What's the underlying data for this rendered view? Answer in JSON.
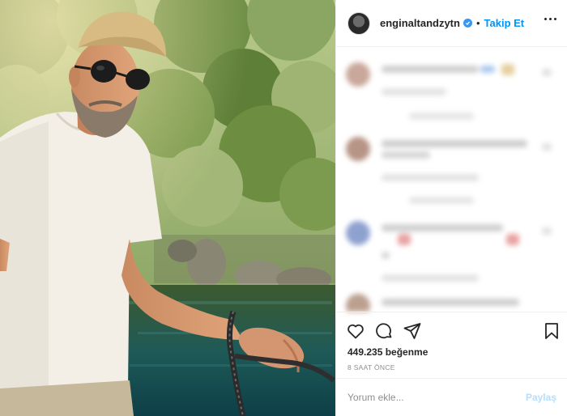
{
  "post": {
    "author": {
      "username": "enginaltandzytn",
      "verified": true,
      "follow_label": "Takip Et",
      "separator": "•"
    },
    "likes_text": "449.235 beğenme",
    "time_text": "8 SAAT ÖNCE",
    "comment": {
      "placeholder": "Yorum ekle...",
      "post_label": "Paylaş"
    },
    "icons": {
      "more": "more-options-icon",
      "like": "heart-icon",
      "comment": "comment-icon",
      "share": "share-icon",
      "save": "bookmark-icon",
      "verified": "verified-badge-icon"
    },
    "colors": {
      "accent": "#0095f6",
      "verified": "#3897f0",
      "post_disabled": "#b2dffc",
      "muted_text": "#8e8e8e",
      "border": "#efefef"
    }
  }
}
